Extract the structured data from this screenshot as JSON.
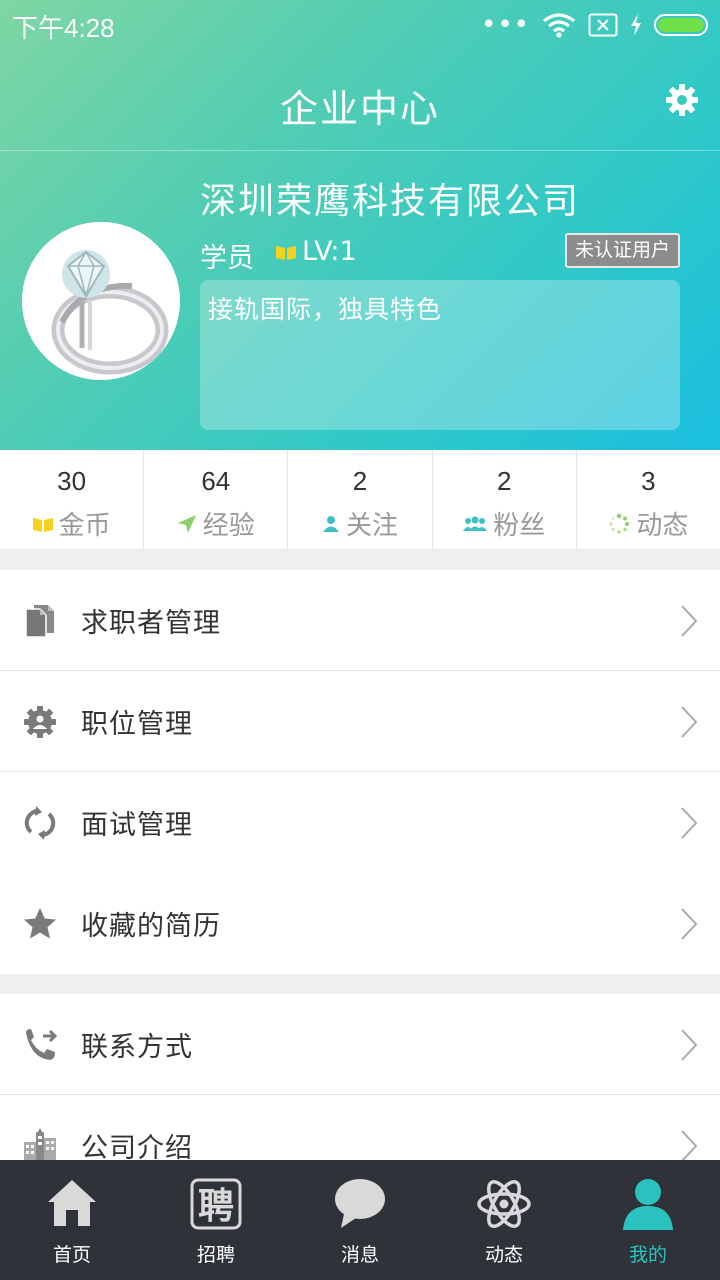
{
  "status_bar": {
    "time": "下午4:28",
    "signal": "•••"
  },
  "header": {
    "title": "企业中心"
  },
  "profile": {
    "company_name": "深圳荣鹰科技有限公司",
    "role": "学员",
    "level": "LV:1",
    "verify_badge": "未认证用户",
    "motto": "接轨国际，独具特色"
  },
  "stats": [
    {
      "value": "30",
      "label": "金币"
    },
    {
      "value": "64",
      "label": "经验"
    },
    {
      "value": "2",
      "label": "关注"
    },
    {
      "value": "2",
      "label": "粉丝"
    },
    {
      "value": "3",
      "label": "动态"
    }
  ],
  "menu": {
    "group1": [
      {
        "label": "求职者管理"
      },
      {
        "label": "职位管理"
      },
      {
        "label": "面试管理"
      },
      {
        "label": "收藏的简历"
      }
    ],
    "group2": [
      {
        "label": "联系方式"
      },
      {
        "label": "公司介绍"
      }
    ]
  },
  "tabs": [
    {
      "label": "首页"
    },
    {
      "label": "招聘",
      "glyph": "聘"
    },
    {
      "label": "消息"
    },
    {
      "label": "动态"
    },
    {
      "label": "我的"
    }
  ],
  "colors": {
    "accent": "#2bc3c0",
    "tab_bg": "#2f3238",
    "gold": "#f5d21e"
  }
}
